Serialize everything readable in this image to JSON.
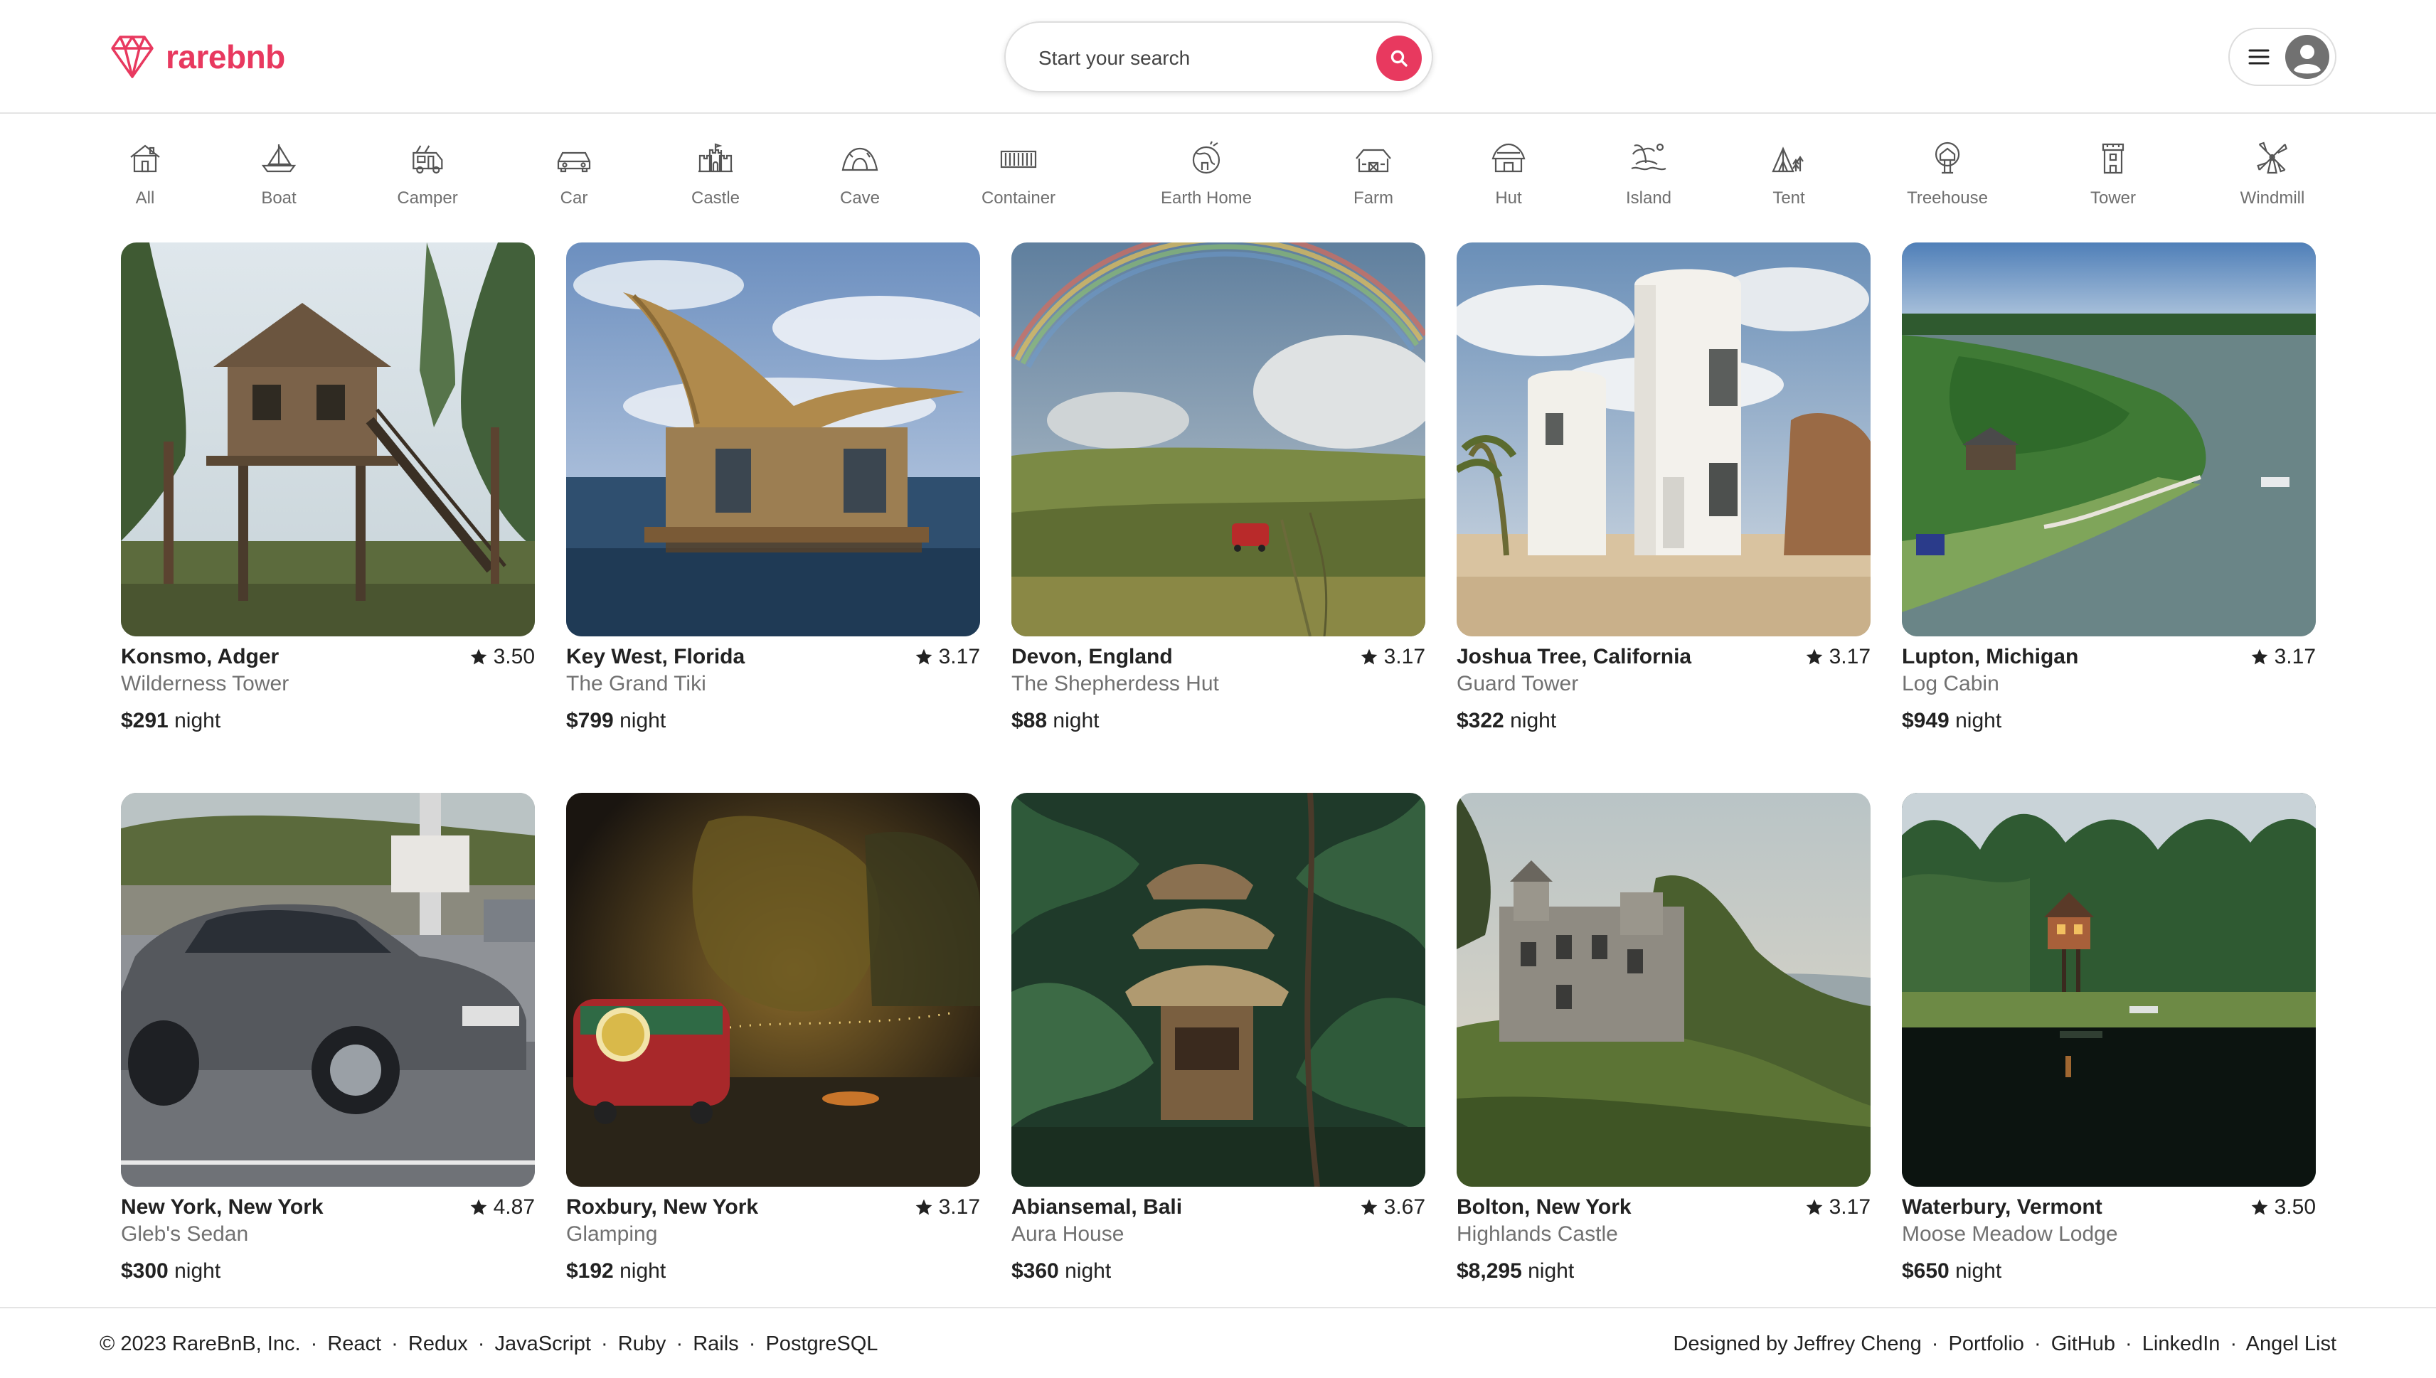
{
  "header": {
    "logo_text": "rarebnb",
    "search_placeholder": "Start your search",
    "brand_color": "#e8395f"
  },
  "categories": [
    {
      "label": "All",
      "icon": "house-icon"
    },
    {
      "label": "Boat",
      "icon": "boat-icon"
    },
    {
      "label": "Camper",
      "icon": "camper-icon"
    },
    {
      "label": "Car",
      "icon": "car-icon"
    },
    {
      "label": "Castle",
      "icon": "castle-icon"
    },
    {
      "label": "Cave",
      "icon": "cave-icon"
    },
    {
      "label": "Container",
      "icon": "container-icon"
    },
    {
      "label": "Earth Home",
      "icon": "earth-home-icon"
    },
    {
      "label": "Farm",
      "icon": "farm-icon"
    },
    {
      "label": "Hut",
      "icon": "hut-icon"
    },
    {
      "label": "Island",
      "icon": "island-icon"
    },
    {
      "label": "Tent",
      "icon": "tent-icon"
    },
    {
      "label": "Treehouse",
      "icon": "treehouse-icon"
    },
    {
      "label": "Tower",
      "icon": "tower-icon"
    },
    {
      "label": "Windmill",
      "icon": "windmill-icon"
    }
  ],
  "listings": [
    {
      "location": "Konsmo, Adger",
      "name": "Wilderness Tower",
      "rating": "3.50",
      "price": "$291",
      "price_unit": "night"
    },
    {
      "location": "Key West, Florida",
      "name": "The Grand Tiki",
      "rating": "3.17",
      "price": "$799",
      "price_unit": "night"
    },
    {
      "location": "Devon, England",
      "name": "The Shepherdess Hut",
      "rating": "3.17",
      "price": "$88",
      "price_unit": "night"
    },
    {
      "location": "Joshua Tree, California",
      "name": "Guard Tower",
      "rating": "3.17",
      "price": "$322",
      "price_unit": "night"
    },
    {
      "location": "Lupton, Michigan",
      "name": "Log Cabin",
      "rating": "3.17",
      "price": "$949",
      "price_unit": "night"
    },
    {
      "location": "New York, New York",
      "name": "Gleb's Sedan",
      "rating": "4.87",
      "price": "$300",
      "price_unit": "night"
    },
    {
      "location": "Roxbury, New York",
      "name": "Glamping",
      "rating": "3.17",
      "price": "$192",
      "price_unit": "night"
    },
    {
      "location": "Abiansemal, Bali",
      "name": "Aura House",
      "rating": "3.67",
      "price": "$360",
      "price_unit": "night"
    },
    {
      "location": "Bolton, New York",
      "name": "Highlands Castle",
      "rating": "3.17",
      "price": "$8,295",
      "price_unit": "night"
    },
    {
      "location": "Waterbury, Vermont",
      "name": "Moose Meadow Lodge",
      "rating": "3.50",
      "price": "$650",
      "price_unit": "night"
    }
  ],
  "footer": {
    "left": [
      "© 2023 RareBnB, Inc.",
      "React",
      "Redux",
      "JavaScript",
      "Ruby",
      "Rails",
      "PostgreSQL"
    ],
    "right": [
      "Designed by Jeffrey Cheng",
      "Portfolio",
      "GitHub",
      "LinkedIn",
      "Angel List"
    ],
    "separator": "·"
  }
}
